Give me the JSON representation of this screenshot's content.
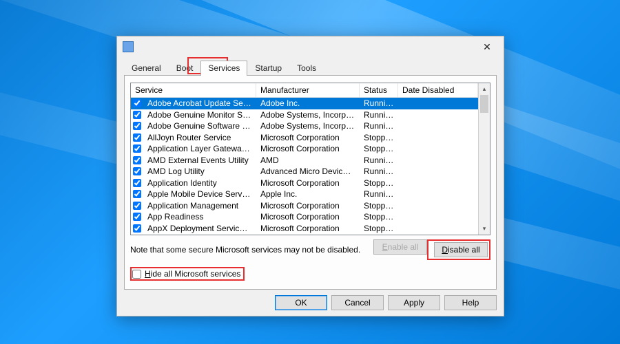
{
  "titlebar": {
    "title": ""
  },
  "tabs": {
    "items": [
      "General",
      "Boot",
      "Services",
      "Startup",
      "Tools"
    ],
    "active_index": 2
  },
  "columns": {
    "service": "Service",
    "manufacturer": "Manufacturer",
    "status": "Status",
    "date_disabled": "Date Disabled"
  },
  "rows": [
    {
      "checked": true,
      "selected": true,
      "service": "Adobe Acrobat Update Service",
      "manufacturer": "Adobe Inc.",
      "status": "Running",
      "date_disabled": ""
    },
    {
      "checked": true,
      "selected": false,
      "service": "Adobe Genuine Monitor Service",
      "manufacturer": "Adobe Systems, Incorpora...",
      "status": "Running",
      "date_disabled": ""
    },
    {
      "checked": true,
      "selected": false,
      "service": "Adobe Genuine Software Integri...",
      "manufacturer": "Adobe Systems, Incorpora...",
      "status": "Running",
      "date_disabled": ""
    },
    {
      "checked": true,
      "selected": false,
      "service": "AllJoyn Router Service",
      "manufacturer": "Microsoft Corporation",
      "status": "Stopped",
      "date_disabled": ""
    },
    {
      "checked": true,
      "selected": false,
      "service": "Application Layer Gateway Service",
      "manufacturer": "Microsoft Corporation",
      "status": "Stopped",
      "date_disabled": ""
    },
    {
      "checked": true,
      "selected": false,
      "service": "AMD External Events Utility",
      "manufacturer": "AMD",
      "status": "Running",
      "date_disabled": ""
    },
    {
      "checked": true,
      "selected": false,
      "service": "AMD Log Utility",
      "manufacturer": "Advanced Micro Devices, I...",
      "status": "Running",
      "date_disabled": ""
    },
    {
      "checked": true,
      "selected": false,
      "service": "Application Identity",
      "manufacturer": "Microsoft Corporation",
      "status": "Stopped",
      "date_disabled": ""
    },
    {
      "checked": true,
      "selected": false,
      "service": "Apple Mobile Device Service",
      "manufacturer": "Apple Inc.",
      "status": "Running",
      "date_disabled": ""
    },
    {
      "checked": true,
      "selected": false,
      "service": "Application Management",
      "manufacturer": "Microsoft Corporation",
      "status": "Stopped",
      "date_disabled": ""
    },
    {
      "checked": true,
      "selected": false,
      "service": "App Readiness",
      "manufacturer": "Microsoft Corporation",
      "status": "Stopped",
      "date_disabled": ""
    },
    {
      "checked": true,
      "selected": false,
      "service": "AppX Deployment Service (AppX...",
      "manufacturer": "Microsoft Corporation",
      "status": "Stopped",
      "date_disabled": ""
    }
  ],
  "note": "Note that some secure Microsoft services may not be disabled.",
  "buttons": {
    "enable_all": "Enable all",
    "disable_all": "Disable all",
    "ok": "OK",
    "cancel": "Cancel",
    "apply": "Apply",
    "help": "Help"
  },
  "hide_checkbox": {
    "checked": false,
    "prefix": "H",
    "rest": "ide all Microsoft services"
  }
}
